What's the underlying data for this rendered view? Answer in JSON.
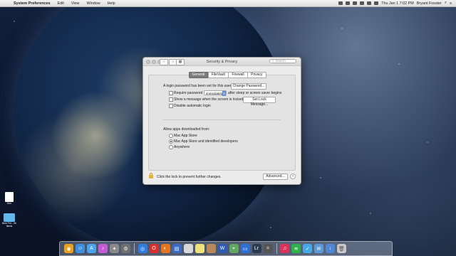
{
  "menubar": {
    "app": "System Preferences",
    "items": [
      "Edit",
      "View",
      "Window",
      "Help"
    ],
    "clock": "Thu Jan 1  7:02 PM",
    "user": "Bryant Fosster"
  },
  "window": {
    "title": "Security & Privacy",
    "search_placeholder": "Search",
    "tabs": [
      "General",
      "FileVault",
      "Firewall",
      "Privacy"
    ],
    "selected_tab": "General",
    "login_text": "A login password has been set for this user",
    "change_password": "Change Password...",
    "require_password_label": "Require password",
    "require_password_value": "immediately",
    "require_password_suffix": "after sleep or screen saver begins",
    "show_message_label": "Show a message when the screen is locked",
    "set_lock_message": "Set Lock Message...",
    "disable_login_label": "Disable automatic login",
    "allow_apps_heading": "Allow apps downloaded from:",
    "options": [
      "Mac App Store",
      "Mac App Store and identified developers",
      "Anywhere"
    ],
    "selected_option": 1,
    "lock_text": "Click the lock to prevent further changes.",
    "advanced": "Advanced...",
    "help": "?"
  },
  "desktop": {
    "folder_label": "New Fol... ith Items",
    "doc_label": "Doc"
  },
  "dock": {
    "icons": [
      "chrome-icon",
      "finder-icon",
      "app-store-icon",
      "itunes-icon",
      "launchpad-icon",
      "system-preferences-icon",
      "safari-icon",
      "opera-icon",
      "firefox-icon",
      "disk-utility-icon",
      "file-icon",
      "notes-icon",
      "photo-icon",
      "word-icon",
      "maps-icon",
      "keynote-icon",
      "lightroom-icon",
      "calculator-icon",
      "music-icon",
      "spotify-icon",
      "twitter-icon",
      "mail-icon",
      "downloads-icon",
      "trash-icon"
    ]
  },
  "colors": {
    "accent": "#6c8fdc",
    "lock": "#e2b23b"
  }
}
